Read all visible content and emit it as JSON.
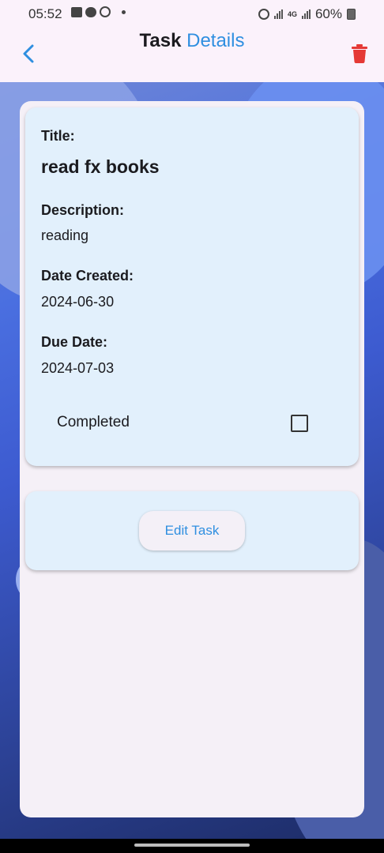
{
  "status_bar": {
    "time": "05:52",
    "battery": "60%",
    "network": "4G"
  },
  "app_bar": {
    "title_part1": "Task",
    "title_part2": "Details",
    "accent_color": "#2f8fe0",
    "delete_color": "#e53935",
    "back_icon": "chevron-left-icon",
    "delete_icon": "trash-icon"
  },
  "task": {
    "title_label": "Title:",
    "title_value": "read fx books",
    "description_label": "Description:",
    "description_value": "reading",
    "date_created_label": "Date Created:",
    "date_created_value": "2024-06-30",
    "due_date_label": "Due Date:",
    "due_date_value": "2024-07-03",
    "completed_label": "Completed",
    "completed": false
  },
  "actions": {
    "edit_label": "Edit Task"
  }
}
